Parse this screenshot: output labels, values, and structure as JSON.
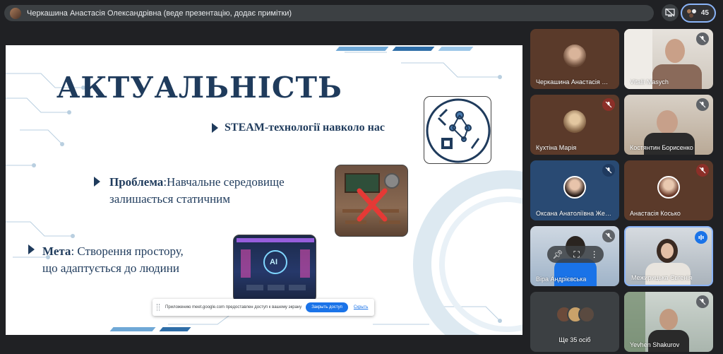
{
  "header": {
    "presenter_title": "Черкашина Анастасія Олександрівна (веде презентацію, додає примітки)",
    "participant_count": "45"
  },
  "slide": {
    "title": "АКТУАЛЬНІСТЬ",
    "point1": "STEAM-технології навколо нас",
    "point2_bold": "Проблема",
    "point2_line1": ":Навчальне середовище",
    "point2_line2": "залишається статичним",
    "point3_bold": "Мета",
    "point3_line1": ": Створення простору,",
    "point3_line2": "що адаптується до людини",
    "ai_label": "AI"
  },
  "share_bar": {
    "message": "Приложению meet.google.com предоставлен доступ к вашему экрану",
    "close_label": "Закрыть доступ",
    "hide_label": "Скрыть"
  },
  "participants": [
    {
      "name": "Черкашина Анастасія Ол..."
    },
    {
      "name": "Vitalii Masych"
    },
    {
      "name": "Кухтіна Марія"
    },
    {
      "name": "Костянтин Борисенко"
    },
    {
      "name": "Оксана Анатоліївна Жер..."
    },
    {
      "name": "Анастасія Косько"
    },
    {
      "name": "Віра Андрієвська"
    },
    {
      "name": "Межирицька Євгенія"
    },
    {
      "name": "Ще 35 осіб"
    },
    {
      "name": "Yevhen Shakurov"
    }
  ],
  "colors": {
    "slide_navy": "#1f3b5c",
    "accent_blue": "#8ab4f8",
    "share_button": "#1a73e8",
    "muted_red": "#c5221f"
  }
}
